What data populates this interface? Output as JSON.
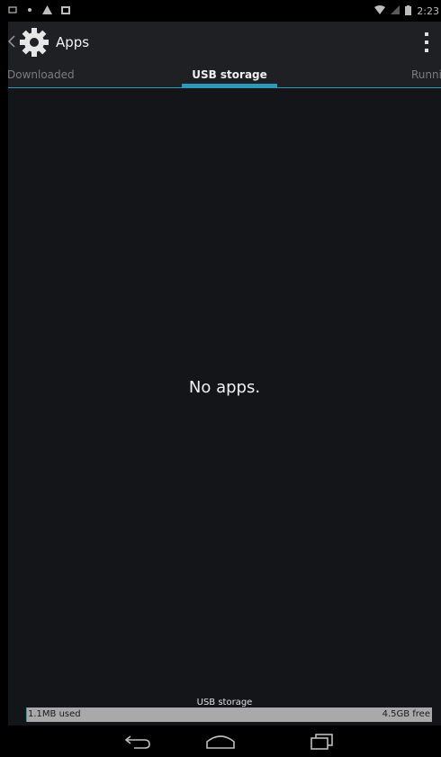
{
  "status_bar": {
    "time": "2:23",
    "left_icons": [
      "notification-icon",
      "download-icon",
      "warning-icon",
      "image-icon"
    ],
    "right_icons": [
      "wifi-icon",
      "signal-icon",
      "battery-icon"
    ]
  },
  "action_bar": {
    "title": "Apps",
    "back_icon": "chevron-left-icon",
    "app_icon": "settings-gear-icon",
    "menu_icon": "overflow-menu-icon"
  },
  "tabs": [
    {
      "label": "Downloaded",
      "selected": false
    },
    {
      "label": "USB storage",
      "selected": true
    },
    {
      "label": "Runnin",
      "selected": false
    }
  ],
  "content": {
    "empty_message": "No apps."
  },
  "storage": {
    "caption": "USB storage",
    "used_label": "1.1MB used",
    "free_label": "4.5GB free"
  },
  "nav_bar": {
    "buttons": [
      "back-icon",
      "home-icon",
      "recents-icon"
    ]
  },
  "colors": {
    "accent": "#2d9ab7",
    "background": "#141518",
    "action_bar": "#1f2023"
  }
}
